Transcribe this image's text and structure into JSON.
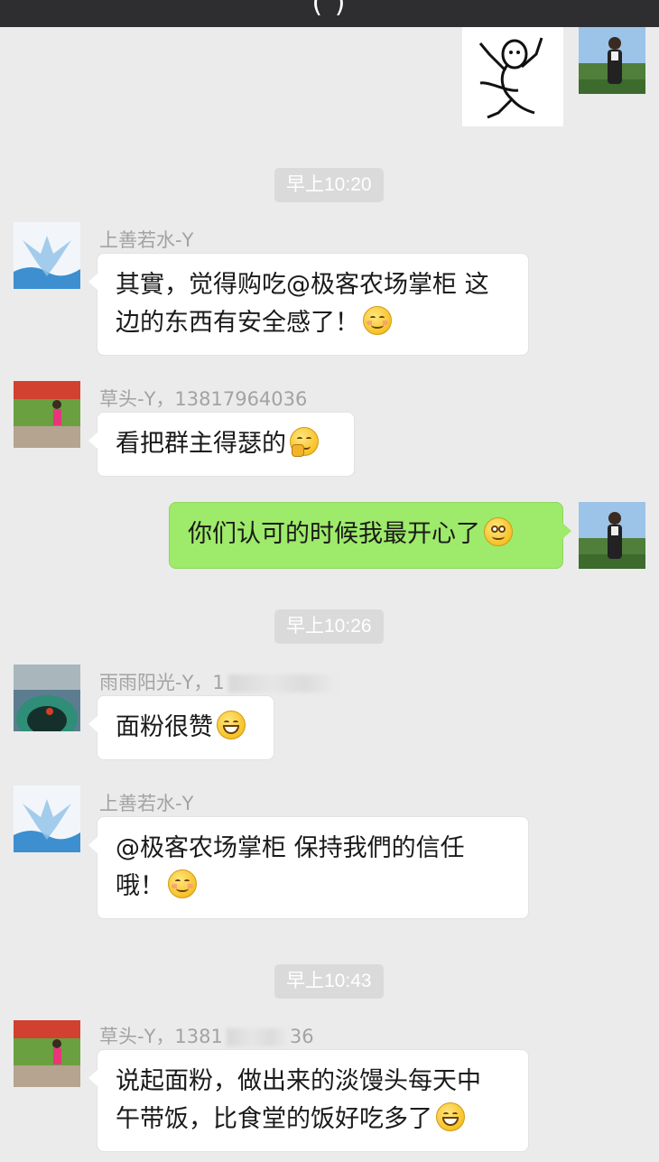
{
  "topbar": {
    "title": "(   )"
  },
  "messages": {
    "t1": "早上10:20",
    "m1_sender": "上善若水-Y",
    "m1_line1": "其實，觉得购吃@极客农场掌柜  这",
    "m1_line2": "边的东西有安全感了！",
    "m2_sender": "草头-Y，13817964036",
    "m2_text": "看把群主得瑟的",
    "m3_text": "你们认可的时候我最开心了",
    "t2": "早上10:26",
    "m4_sender": "雨雨阳光-Y，1",
    "m4_text": "面粉很赞",
    "m5_sender": "上善若水-Y",
    "m5_line1": "@极客农场掌柜  保持我們的信任",
    "m5_line2": "哦！",
    "t3": "早上10:43",
    "m6_sender_a": "草头-Y，1381",
    "m6_sender_b": "36",
    "m6_line1": "说起面粉，做出来的淡馒头每天中",
    "m6_line2": "午带饭，比食堂的饭好吃多了"
  },
  "colors": {
    "outgoing_bubble": "#9eea6a",
    "incoming_bubble": "#ffffff",
    "background": "#ebebeb"
  },
  "icons": [
    "dancing-sticker",
    "smile-emoji",
    "thinking-emoji",
    "smirk-emoji",
    "grin-emoji"
  ]
}
